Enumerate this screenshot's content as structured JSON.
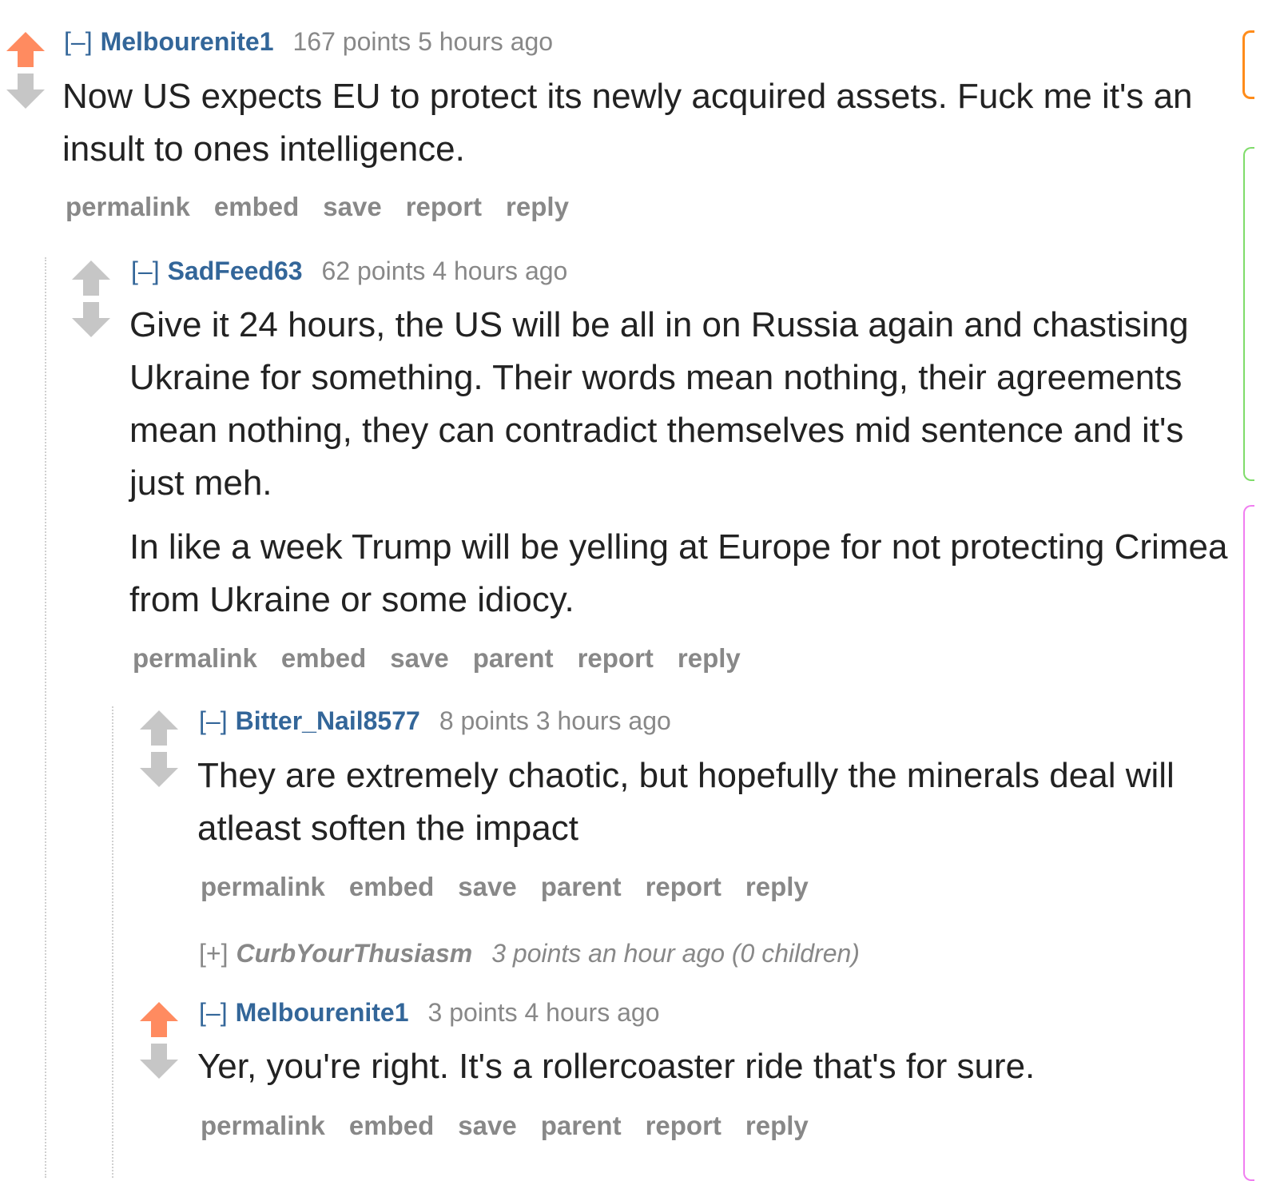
{
  "comments": [
    {
      "expand": "[–]",
      "author": "Melbourenite1",
      "score": "167 points 5 hours ago",
      "body": [
        "Now US expects EU to protect its newly acquired assets. Fuck me it's an insult to ones intelligence."
      ],
      "buttons": [
        "permalink",
        "embed",
        "save",
        "report",
        "reply"
      ],
      "upvoted": true
    },
    {
      "expand": "[–]",
      "author": "SadFeed63",
      "score": "62 points 4 hours ago",
      "body": [
        "Give it 24 hours, the US will be all in on Russia again and chastising Ukraine for something. Their words mean nothing, their agreements mean nothing, they can contradict themselves mid sentence and it's just meh.",
        "In like a week Trump will be yelling at Europe for not protecting Crimea from Ukraine or some idiocy."
      ],
      "buttons": [
        "permalink",
        "embed",
        "save",
        "parent",
        "report",
        "reply"
      ],
      "upvoted": false
    },
    {
      "expand": "[–]",
      "author": "Bitter_Nail8577",
      "score": "8 points 3 hours ago",
      "body": [
        "They are extremely chaotic, but hopefully the minerals deal will atleast soften the impact"
      ],
      "buttons": [
        "permalink",
        "embed",
        "save",
        "parent",
        "report",
        "reply"
      ],
      "upvoted": false
    },
    {
      "expand": "[–]",
      "author": "Melbourenite1",
      "score": "3 points 4 hours ago",
      "body": [
        "Yer, you're right. It's a rollercoaster ride that's for sure."
      ],
      "buttons": [
        "permalink",
        "embed",
        "save",
        "parent",
        "report",
        "reply"
      ],
      "upvoted": true
    }
  ],
  "collapsed_comment": {
    "expand": "[+]",
    "author": "CurbYourThusiasm",
    "score": "3 points an hour ago (0 children)"
  },
  "colors": {
    "upvote": "#ff8b60",
    "neutral_arrow": "#c6c6c6",
    "author": "#336699",
    "meta": "#888888",
    "edge_orange": "#ff8c1a",
    "edge_green": "#7fdc6a",
    "edge_pink": "#f07ef0"
  }
}
